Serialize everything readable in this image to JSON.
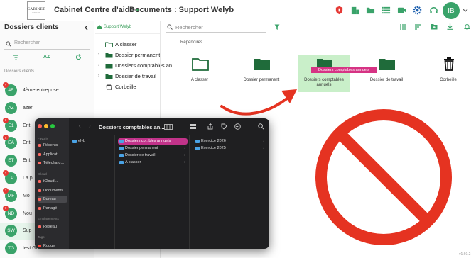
{
  "header": {
    "logo_text": "CABINET",
    "logo_sub": "comptable",
    "app_name": "Cabinet Centre d'aide",
    "page_title": "Documents : Support Welyb",
    "avatar_initials": "IB",
    "brand_color": "#3aa36a"
  },
  "sidebar": {
    "title": "Dossiers clients",
    "collapse_icon": "chevron-left-icon",
    "search_placeholder": "Rechercher",
    "sort_label": "AZ",
    "section_label": "Dossiers clients",
    "clients": [
      {
        "initials": "4E",
        "name": "4ème entreprise",
        "badge": "1"
      },
      {
        "initials": "AZ",
        "name": "azer",
        "badge": ""
      },
      {
        "initials": "E1",
        "name": "Ent",
        "badge": "1"
      },
      {
        "initials": "EA",
        "name": "Ent",
        "badge": "1"
      },
      {
        "initials": "ET",
        "name": "Ent",
        "badge": ""
      },
      {
        "initials": "LP",
        "name": "La p",
        "badge": "1"
      },
      {
        "initials": "MF",
        "name": "Mo",
        "badge": "1"
      },
      {
        "initials": "ND",
        "name": "Nou",
        "badge": "7"
      },
      {
        "initials": "SW",
        "name": "Sup",
        "badge": ""
      },
      {
        "initials": "TG",
        "name": "test GED",
        "badge": ""
      }
    ]
  },
  "tree": {
    "breadcrumb": "Support Welyb",
    "items": [
      {
        "label": "A classer",
        "chevron": ""
      },
      {
        "label": "Dossier permanent",
        "chevron": "›"
      },
      {
        "label": "Dossiers comptables an",
        "chevron": "›"
      },
      {
        "label": "Dossier de travail",
        "chevron": "›"
      },
      {
        "label": "Corbeille",
        "chevron": ""
      }
    ]
  },
  "main": {
    "search_placeholder": "Rechercher",
    "section_label": "Répertoires",
    "folders": [
      {
        "label": "A classer"
      },
      {
        "label": "Dossier permanent"
      },
      {
        "label": "Dossiers comptables annuels"
      },
      {
        "label": "Dossier de travail"
      },
      {
        "label": "Corbeille"
      }
    ],
    "drag_tag": "Dossiers comptables annuels",
    "version": "v1.60.2"
  },
  "finder": {
    "title": "Dossiers comptables an...",
    "sidebar_sections": {
      "favorites": "Favoris",
      "icloud": "iCloud",
      "locations": "Emplacements",
      "tags": "Tags"
    },
    "favorites": [
      "Récents",
      "Applicati...",
      "Télécharg..."
    ],
    "icloud": [
      "iCloud...",
      "Documents",
      "Bureau",
      "Partagé"
    ],
    "locations": [
      "Réseau"
    ],
    "tags": [
      "Rouge"
    ],
    "col1": [
      "elyb"
    ],
    "col2": [
      "Dossiers co...bles annuels",
      "Dossier permanent",
      "Dossier de travail",
      "A classer"
    ],
    "col3": [
      "Exercice 2026",
      "Exercice 2025"
    ]
  }
}
